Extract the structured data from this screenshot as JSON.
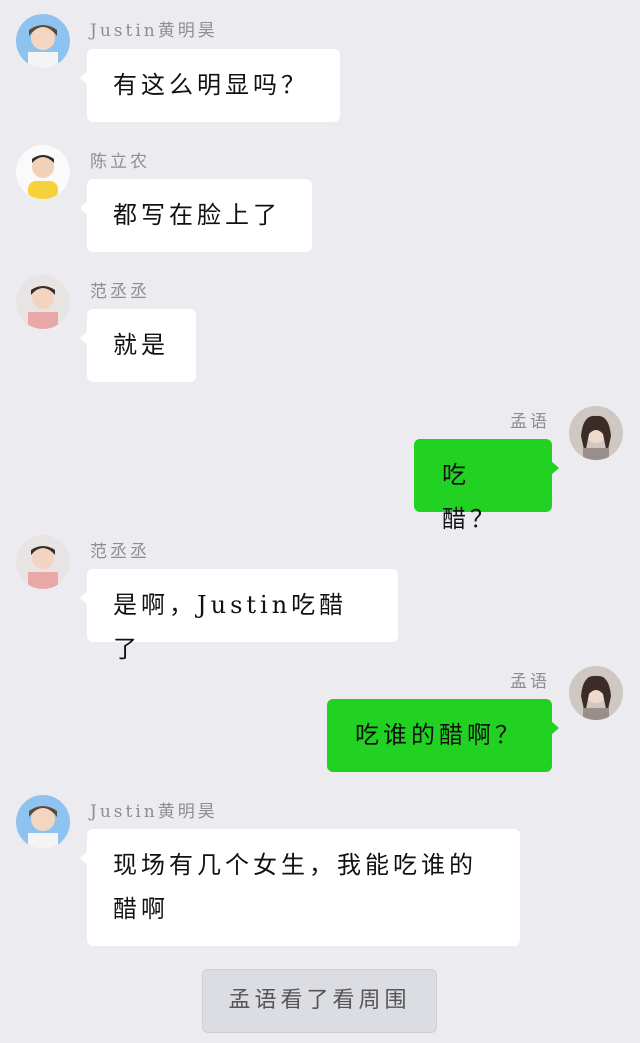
{
  "messages": [
    {
      "side": "left",
      "sender": "Justin黄明昊",
      "avatar": "avatar-justin",
      "text": "有这么明显吗？"
    },
    {
      "side": "left",
      "sender": "陈立农",
      "avatar": "avatar-chen",
      "text": "都写在脸上了"
    },
    {
      "side": "left",
      "sender": "范丞丞",
      "avatar": "avatar-fan",
      "text": "就是"
    },
    {
      "side": "right",
      "sender": "孟语",
      "avatar": "avatar-mengyu",
      "text": "吃醋？"
    },
    {
      "side": "left",
      "sender": "范丞丞",
      "avatar": "avatar-fan",
      "text": "是啊，Justin吃醋了"
    },
    {
      "side": "right",
      "sender": "孟语",
      "avatar": "avatar-mengyu",
      "text": "吃谁的醋啊？"
    },
    {
      "side": "left",
      "sender": "Justin黄明昊",
      "avatar": "avatar-justin",
      "text_line1": "现场有几个女生，我能吃谁的",
      "text_line2": "醋啊"
    }
  ],
  "footer": {
    "label": "孟语看了看周围"
  },
  "colors": {
    "background": "#ececf0",
    "incoming_bubble": "#ffffff",
    "outgoing_bubble": "#22d222",
    "sender_name": "#8d8d92"
  }
}
